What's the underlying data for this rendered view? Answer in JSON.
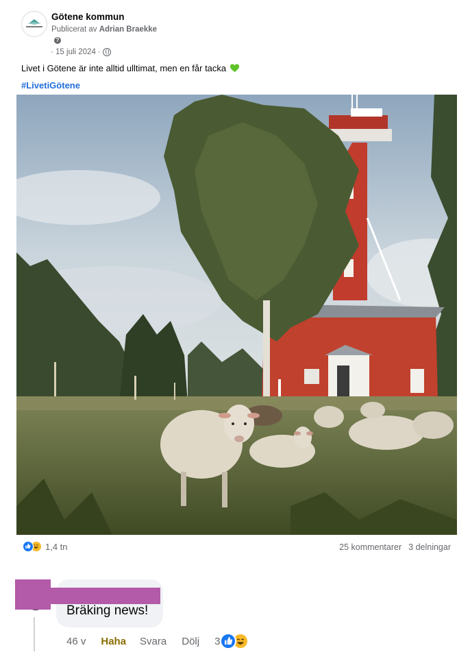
{
  "post": {
    "author": "Götene kommun",
    "published_prefix": "Publicerat av",
    "publisher": "Adrian Braekke",
    "date": "· 15 juli 2024 ·",
    "text": "Livet i Götene är inte alltid ulltimat, men en får tacka",
    "hashtag": "#LivetiGötene",
    "logo_text": "Götene kommun"
  },
  "reactions": {
    "count": "1,4 tn",
    "comments": "25 kommentarer",
    "shares": "3 delningar"
  },
  "comment": {
    "text": "Bräking news!",
    "time": "46 v",
    "reaction_label": "Haha",
    "reply": "Svara",
    "hide": "Dölj",
    "reaction_count": "3"
  },
  "icons": {
    "help": "help-icon",
    "audience": "globe-icon",
    "heart": "green-heart-icon",
    "like": "like-reaction-icon",
    "haha": "haha-reaction-icon"
  },
  "colors": {
    "accent": "#216fdb",
    "like": "#1877f2",
    "haha": "#f7b928",
    "redaction": "#b35aa9",
    "heart": "#5fc32a"
  }
}
